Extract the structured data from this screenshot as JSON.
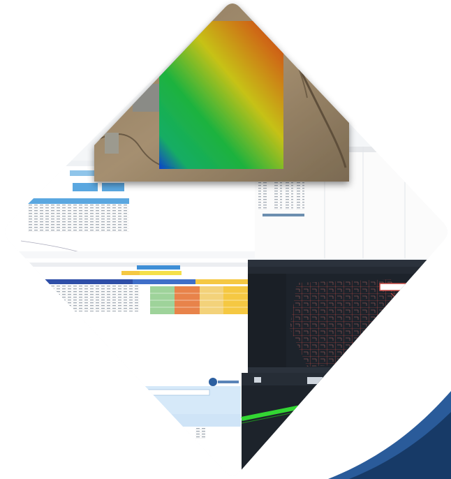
{
  "collage": {
    "panels": [
      {
        "name": "elevation-map-panel",
        "kind": "terrain-heatmap",
        "colors": [
          "#0a3fd0",
          "#19b43c",
          "#e0d010",
          "#c83c08"
        ]
      },
      {
        "name": "spreadsheet-panel-top",
        "kind": "spreadsheet",
        "accent": "#5aa7e0"
      },
      {
        "name": "spreadsheet-panel-right",
        "kind": "spreadsheet"
      },
      {
        "name": "spreadsheet-panel-colored",
        "kind": "spreadsheet",
        "highlight_colors": [
          "#f5c842",
          "#e8834a",
          "#9ed39a",
          "#2f4fa8"
        ]
      },
      {
        "name": "cad-network-panel",
        "kind": "cad-drawing",
        "line_color": "#d9534f",
        "background": "#1d232b"
      },
      {
        "name": "cad-profile-panel",
        "kind": "cad-drawing",
        "line_color": "#33d633",
        "background": "#1d232b"
      },
      {
        "name": "form-panel",
        "kind": "dialog",
        "accent": "#cfe4f7"
      }
    ]
  },
  "brand": {
    "swoosh_color": "#173a67",
    "swoosh_highlight": "#2a5b9a"
  }
}
